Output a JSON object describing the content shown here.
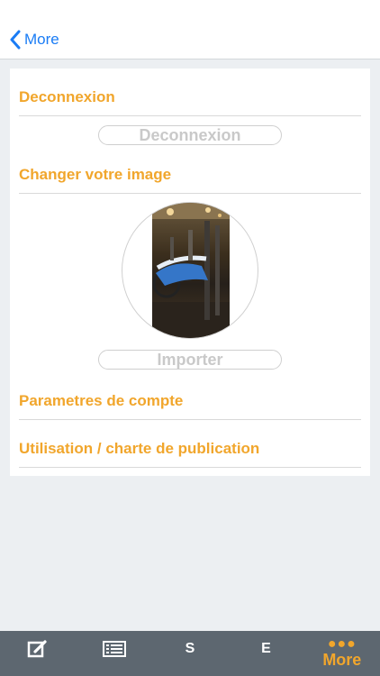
{
  "nav": {
    "back_label": "More"
  },
  "sections": {
    "logout_title": "Deconnexion",
    "logout_button": "Deconnexion",
    "change_image_title": "Changer votre image",
    "import_button": "Importer",
    "account_settings": "Parametres de compte",
    "usage_charter": "Utilisation / charte de publication"
  },
  "tabbar": {
    "tabs": [
      {
        "icon": "edit-icon"
      },
      {
        "icon": "list-icon"
      },
      {
        "label": "S"
      },
      {
        "label": "E"
      },
      {
        "icon": "more-dots-icon",
        "label": "More"
      }
    ],
    "active_color": "#f1a62c",
    "background": "#5d6770"
  },
  "colors": {
    "accent": "#f1a62c",
    "link": "#1a7cf5"
  }
}
